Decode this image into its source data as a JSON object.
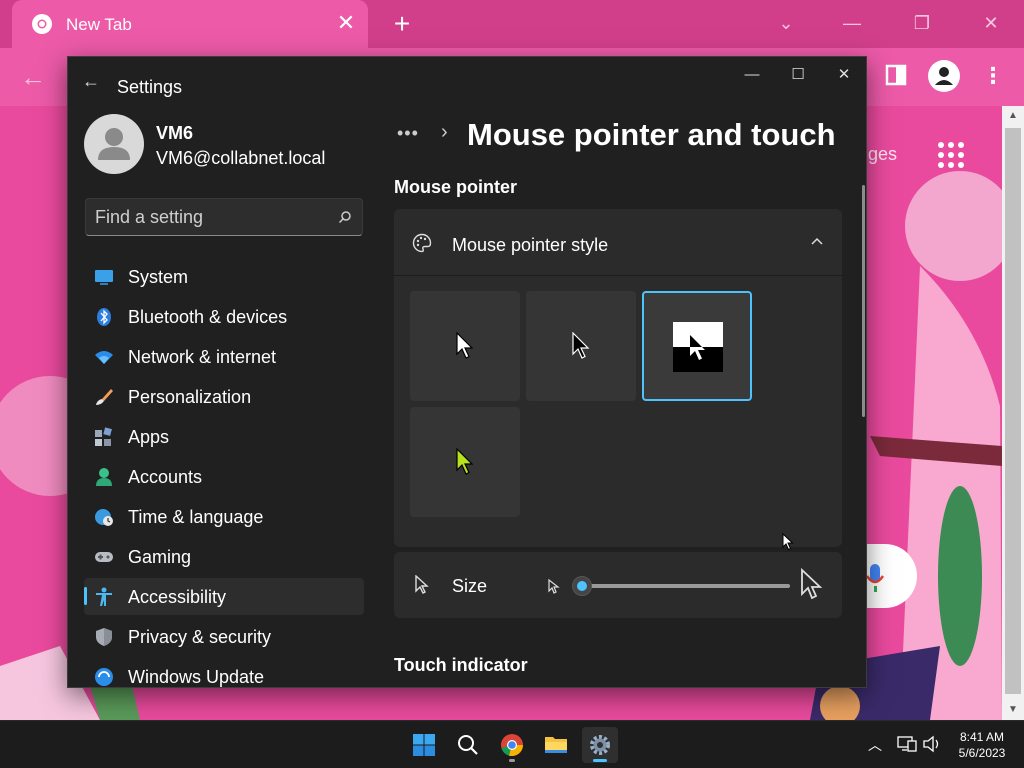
{
  "browser": {
    "tab_title": "New Tab",
    "page_partial_link": "ges",
    "theme_color": "#e84a9c"
  },
  "settings": {
    "app_title": "Settings",
    "user": {
      "name": "VM6",
      "email": "VM6@collabnet.local"
    },
    "search": {
      "placeholder": "Find a setting"
    },
    "nav": [
      {
        "label": "System",
        "icon": "system-monitor-icon"
      },
      {
        "label": "Bluetooth & devices",
        "icon": "bluetooth-icon"
      },
      {
        "label": "Network & internet",
        "icon": "wifi-icon"
      },
      {
        "label": "Personalization",
        "icon": "paintbrush-icon"
      },
      {
        "label": "Apps",
        "icon": "apps-icon"
      },
      {
        "label": "Accounts",
        "icon": "person-icon"
      },
      {
        "label": "Time & language",
        "icon": "globe-clock-icon"
      },
      {
        "label": "Gaming",
        "icon": "gamepad-icon"
      },
      {
        "label": "Accessibility",
        "icon": "accessibility-icon",
        "selected": true
      },
      {
        "label": "Privacy & security",
        "icon": "shield-icon"
      },
      {
        "label": "Windows Update",
        "icon": "update-icon"
      }
    ],
    "breadcrumb_more": "•••",
    "page_title": "Mouse pointer and touch",
    "sections": {
      "mouse_pointer": "Mouse pointer",
      "touch_indicator": "Touch indicator"
    },
    "pointer_style": {
      "label": "Mouse pointer style",
      "expanded": true,
      "options": [
        {
          "name": "white",
          "selected": false
        },
        {
          "name": "black",
          "selected": false
        },
        {
          "name": "inverted",
          "selected": true
        },
        {
          "name": "custom",
          "selected": false,
          "color": "#b7e21d"
        }
      ]
    },
    "size": {
      "label": "Size",
      "value": 1,
      "min": 1,
      "max": 15
    },
    "accent_color": "#4cc2ff"
  },
  "taskbar": {
    "apps": [
      "start-icon",
      "search-icon",
      "chrome-icon",
      "file-explorer-icon",
      "settings-gear-icon"
    ],
    "time": "8:41 AM",
    "date": "5/6/2023"
  }
}
